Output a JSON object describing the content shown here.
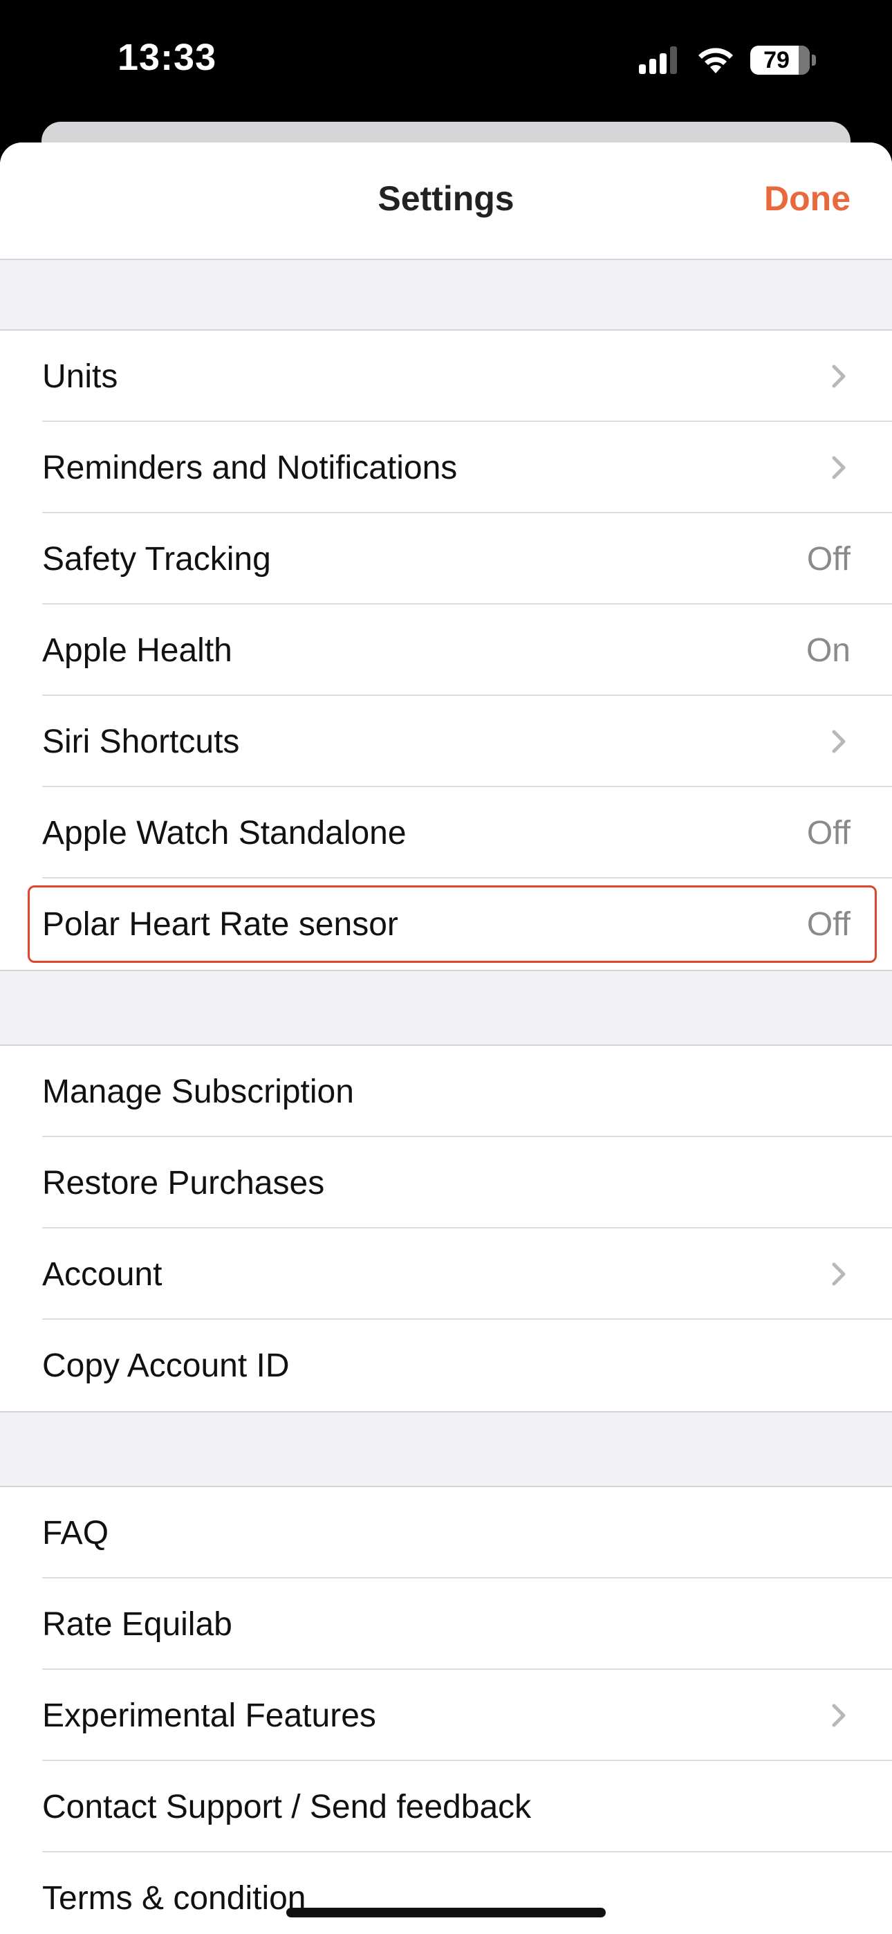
{
  "status_bar": {
    "time": "13:33",
    "battery": "79"
  },
  "nav": {
    "title": "Settings",
    "done_label": "Done"
  },
  "accent_color": "#e8693e",
  "groups": [
    {
      "rows": [
        {
          "label": "Units",
          "accessory": "chevron"
        },
        {
          "label": "Reminders and Notifications",
          "accessory": "chevron"
        },
        {
          "label": "Safety Tracking",
          "value": "Off"
        },
        {
          "label": "Apple Health",
          "value": "On"
        },
        {
          "label": "Siri Shortcuts",
          "accessory": "chevron"
        },
        {
          "label": "Apple Watch Standalone",
          "value": "Off"
        },
        {
          "label": "Polar Heart Rate sensor",
          "value": "Off",
          "highlighted": true
        }
      ]
    },
    {
      "rows": [
        {
          "label": "Manage Subscription"
        },
        {
          "label": "Restore Purchases"
        },
        {
          "label": "Account",
          "accessory": "chevron"
        },
        {
          "label": "Copy Account ID"
        }
      ]
    },
    {
      "rows": [
        {
          "label": "FAQ"
        },
        {
          "label": "Rate Equilab"
        },
        {
          "label": "Experimental Features",
          "accessory": "chevron"
        },
        {
          "label": "Contact Support / Send feedback"
        },
        {
          "label": "Terms & condition"
        }
      ]
    }
  ]
}
